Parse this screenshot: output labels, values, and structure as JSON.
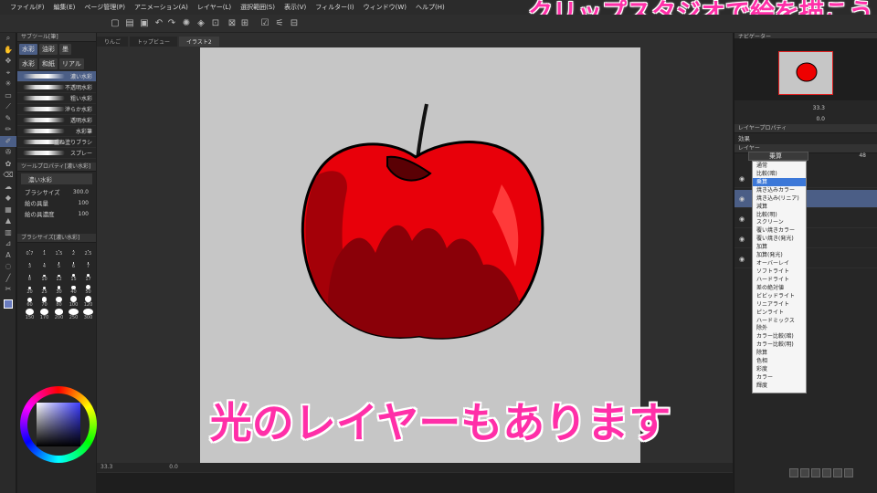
{
  "menu": [
    "ファイル(F)",
    "編集(E)",
    "ページ管理(P)",
    "アニメーション(A)",
    "レイヤー(L)",
    "選択範囲(S)",
    "表示(V)",
    "フィルター(I)",
    "ウィンドウ(W)",
    "ヘルプ(H)"
  ],
  "overlay_title": "クリップスタジオで絵を描こう",
  "subtitle": "光のレイヤーもあります",
  "subtool_panel": {
    "header": "サブツール[筆]",
    "tabs": [
      "水彩",
      "油彩",
      "墨"
    ],
    "tabs2": [
      "水彩",
      "和紙",
      "リアル"
    ],
    "brushes": [
      "濃い水彩",
      "不透明水彩",
      "粗い水彩",
      "滲らか水彩",
      "透明水彩",
      "水彩筆",
      "重ね塗りブラシ",
      "スプレー"
    ],
    "selected_brush_index": 0
  },
  "tool_property": {
    "header": "ツールプロパティ[濃い水彩]",
    "brush_name": "濃い水彩",
    "rows": [
      {
        "label": "ブラシサイズ",
        "value": "300.0"
      },
      {
        "label": "絵の具量",
        "value": "100"
      },
      {
        "label": "絵の具濃度",
        "value": "100"
      }
    ]
  },
  "brush_size_panel": {
    "header": "ブラシサイズ[濃い水彩]",
    "sizes": [
      "0.7",
      "1",
      "1.5",
      "2",
      "2.5",
      "3",
      "4",
      "5",
      "6",
      "7",
      "8",
      "10",
      "12",
      "15",
      "17",
      "20",
      "25",
      "30",
      "40",
      "50",
      "60",
      "70",
      "80",
      "100",
      "120",
      "150",
      "170",
      "200",
      "250",
      "300"
    ]
  },
  "document_tabs": [
    "りんご",
    "トップビュー",
    "イラスト2"
  ],
  "status": {
    "zoom": "33.3",
    "coords": "0.0"
  },
  "right_panel": {
    "navigator_header": "ナビゲーター",
    "zoom_value": "33.3",
    "rotate_value": "0.0",
    "layer_property_header": "レイヤープロパティ",
    "effect_label": "効果",
    "layer_header": "レイヤー",
    "blend_mode_selected": "乗算",
    "opacity": "48"
  },
  "blend_modes": [
    "通常",
    "比較(暗)",
    "乗算",
    "焼き込みカラー",
    "焼き込み(リニア)",
    "減算",
    "比較(明)",
    "スクリーン",
    "覆い焼きカラー",
    "覆い焼き(発光)",
    "加算",
    "加算(発光)",
    "オーバーレイ",
    "ソフトライト",
    "ハードライト",
    "差の絶対値",
    "ビビッドライト",
    "リニアライト",
    "ピンライト",
    "ハードミックス",
    "除外",
    "カラー比較(暗)",
    "カラー比較(明)",
    "除算",
    "色相",
    "彩度",
    "カラー",
    "輝度"
  ],
  "blend_selected_index": 2,
  "colors": {
    "accent": "#4b5e86",
    "overlay_pink": "#ff2fa8",
    "apple_red": "#e8000a",
    "apple_dark": "#8a0008",
    "canvas_bg": "#c6c6c6"
  },
  "icons": [
    "pen-icon",
    "brush-icon",
    "eraser-icon",
    "fill-icon",
    "text-icon",
    "eyedropper-icon",
    "move-icon",
    "zoom-icon",
    "hand-icon",
    "select-icon"
  ]
}
